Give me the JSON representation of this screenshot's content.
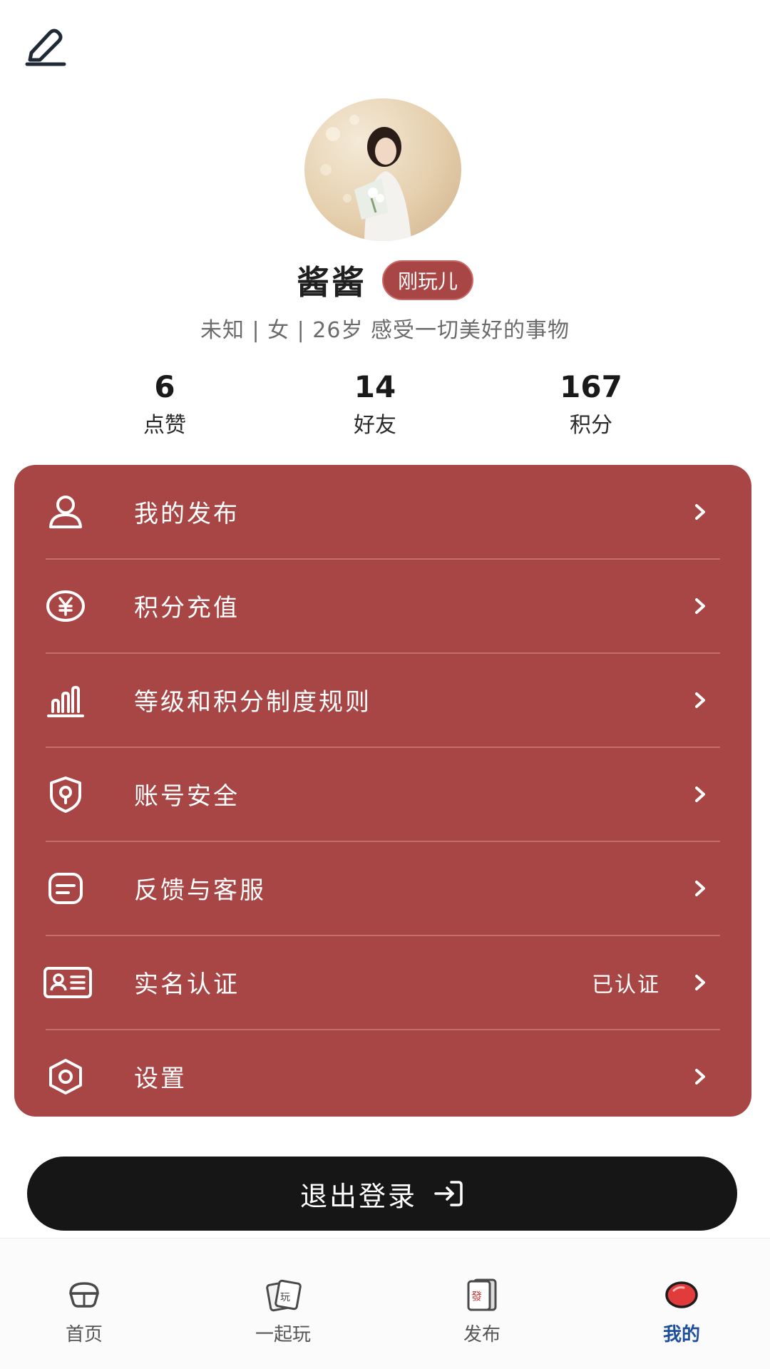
{
  "header": {
    "edit_icon": "edit-pencil-icon"
  },
  "profile": {
    "name": "酱酱",
    "level_badge": "刚玩儿",
    "bio": "未知 | 女 | 26岁 感受一切美好的事物"
  },
  "stats": [
    {
      "value": "6",
      "label": "点赞"
    },
    {
      "value": "14",
      "label": "好友"
    },
    {
      "value": "167",
      "label": "积分"
    }
  ],
  "menu": {
    "items": [
      {
        "label": "我的发布",
        "icon": "user-icon",
        "value": ""
      },
      {
        "label": "积分充值",
        "icon": "yen-coin-icon",
        "value": ""
      },
      {
        "label": "等级和积分制度规则",
        "icon": "bar-chart-icon",
        "value": ""
      },
      {
        "label": "账号安全",
        "icon": "shield-lock-icon",
        "value": ""
      },
      {
        "label": "反馈与客服",
        "icon": "message-icon",
        "value": ""
      },
      {
        "label": "实名认证",
        "icon": "id-card-icon",
        "value": "已认证"
      },
      {
        "label": "设置",
        "icon": "settings-hexagon-icon",
        "value": ""
      }
    ]
  },
  "logout": {
    "label": "退出登录",
    "icon": "logout-arrow-icon"
  },
  "bottom_nav": {
    "items": [
      {
        "label": "首页",
        "icon": "mahjong-home-icon",
        "active": false
      },
      {
        "label": "一起玩",
        "icon": "mahjong-tile-play-icon",
        "active": false
      },
      {
        "label": "发布",
        "icon": "mahjong-tile-fa-icon",
        "active": false
      },
      {
        "label": "我的",
        "icon": "red-bubble-me-icon",
        "active": true
      }
    ]
  },
  "colors": {
    "accent": "#a84645",
    "logout_bg": "#161616",
    "nav_active": "#1d4f9c"
  }
}
